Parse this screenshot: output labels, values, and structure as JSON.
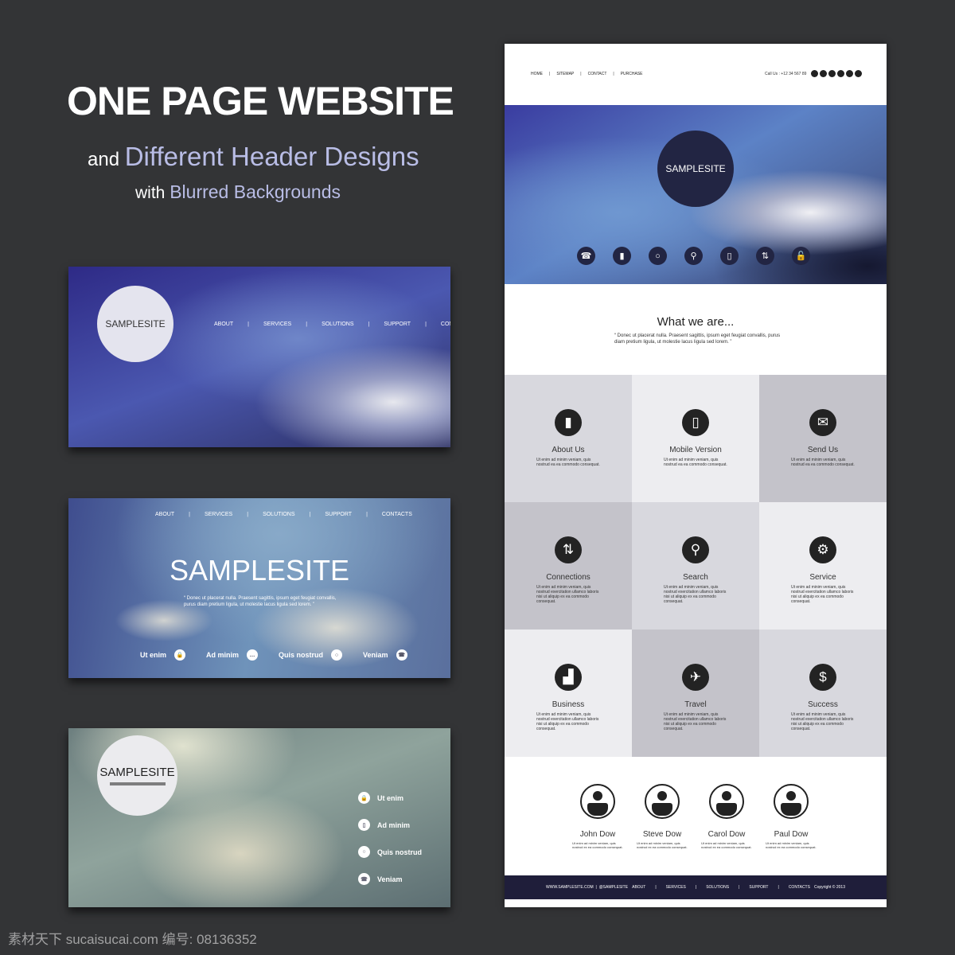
{
  "promo": {
    "title": "ONE PAGE WEBSITE",
    "line2_prefix": "and",
    "line2_accent": "Different Header Designs",
    "line3_prefix": "with",
    "line3_accent": "Blurred Backgrounds"
  },
  "banner1": {
    "logo": "SAMPLESITE",
    "nav": [
      "ABOUT",
      "SERVICES",
      "SOLUTIONS",
      "SUPPORT",
      "CONTACTS"
    ]
  },
  "banner2": {
    "nav": [
      "ABOUT",
      "SERVICES",
      "SOLUTIONS",
      "SUPPORT",
      "CONTACTS"
    ],
    "title": "SAMPLESITE",
    "quote": "Donec ut placerat nulla. Praesent sagittis, ipsum eget feugiat convallis, purus diam pretium ligula, ut molestie lacus ligula sed lorem.",
    "links": [
      {
        "label": "Ut enim",
        "icon": "lock-icon"
      },
      {
        "label": "Ad minim",
        "icon": "chat-icon"
      },
      {
        "label": "Quis nostrud",
        "icon": "circle-icon"
      },
      {
        "label": "Veniam",
        "icon": "phone-icon"
      }
    ]
  },
  "banner3": {
    "logo": "SAMPLESITE",
    "links": [
      {
        "label": "Ut enim",
        "icon": "lock-icon"
      },
      {
        "label": "Ad minim",
        "icon": "mobile-icon"
      },
      {
        "label": "Quis nostrud",
        "icon": "circle-icon"
      },
      {
        "label": "Veniam",
        "icon": "phone-icon"
      }
    ]
  },
  "page": {
    "topnav": [
      "HOME",
      "SITEMAP",
      "CONTACT",
      "PURCHASE"
    ],
    "call": "Call Us : +12 34 567 89",
    "social": [
      "home-icon",
      "star-icon",
      "rss-icon",
      "share-icon",
      "mail-icon",
      "chat-icon"
    ],
    "hero_logo": "SAMPLESITE",
    "hero_icons": [
      {
        "glyph": "☎",
        "name": "phone-icon"
      },
      {
        "glyph": "▮",
        "name": "book-icon"
      },
      {
        "glyph": "○",
        "name": "circle-icon"
      },
      {
        "glyph": "⚲",
        "name": "search-icon"
      },
      {
        "glyph": "▯",
        "name": "mobile-icon"
      },
      {
        "glyph": "⇅",
        "name": "connections-icon"
      },
      {
        "glyph": "🔓",
        "name": "unlock-icon"
      }
    ],
    "about_title": "What we are...",
    "about_quote": "Donec ut placerat nulla. Praesent sagittis, ipsum eget feugiat convallis, purus diam pretium ligula, ut molestie lacus ligula sed lorem.",
    "features": [
      {
        "title": "About Us",
        "icon": "book-icon",
        "glyph": "▮",
        "desc": "Ut enim ad minim veniam, quis nostrud ea ea commodo consequat.",
        "bg": "#d8d8de"
      },
      {
        "title": "Mobile Version",
        "icon": "mobile-icon",
        "glyph": "▯",
        "desc": "Ut enim ad minim veniam, quis nostrud ea ea commodo consequat.",
        "bg": "#ededf0"
      },
      {
        "title": "Send Us",
        "icon": "envelope-icon",
        "glyph": "✉",
        "desc": "Ut enim ad minim veniam, quis nostrud ea ea commodo consequat.",
        "bg": "#c4c3ca"
      },
      {
        "title": "Connections",
        "icon": "connections-icon",
        "glyph": "⇅",
        "desc": "Ut enim ad minim veniam, quis nostrud exercitation ullamco laboris nisi ut aliquip ex ea commodo consequat.",
        "bg": "#c4c3ca"
      },
      {
        "title": "Search",
        "icon": "search-icon",
        "glyph": "⚲",
        "desc": "Ut enim ad minim veniam, quis nostrud exercitation ullamco laboris nisi ut aliquip ex ea commodo consequat.",
        "bg": "#d8d8de"
      },
      {
        "title": "Service",
        "icon": "gear-icon",
        "glyph": "⚙",
        "desc": "Ut enim ad minim veniam, quis nostrud exercitation ullamco laboris nisi ut aliquip ex ea commodo consequat.",
        "bg": "#ededf0"
      },
      {
        "title": "Business",
        "icon": "chart-icon",
        "glyph": "▟",
        "desc": "Ut enim ad minim veniam, quis nostrud exercitation ullamco laboris nisi ut aliquip ex ea commodo consequat.",
        "bg": "#ededf0"
      },
      {
        "title": "Travel",
        "icon": "airplane-icon",
        "glyph": "✈",
        "desc": "Ut enim ad minim veniam, quis nostrud exercitation ullamco laboris nisi ut aliquip ex ea commodo consequat.",
        "bg": "#c4c3ca"
      },
      {
        "title": "Success",
        "icon": "dollar-icon",
        "glyph": "$",
        "desc": "Ut enim ad minim veniam, quis nostrud exercitation ullamco laboris nisi ut aliquip ex ea commodo consequat.",
        "bg": "#d8d8de"
      }
    ],
    "team": [
      {
        "name": "John Dow",
        "desc": "Ut enim ad minim veniam, quis nostrud ex ea commodo consequat."
      },
      {
        "name": "Steve Dow",
        "desc": "Ut enim ad minim veniam, quis nostrud ex ea commodo consequat."
      },
      {
        "name": "Carol Dow",
        "desc": "Ut enim ad minim veniam, quis nostrud ex ea commodo consequat."
      },
      {
        "name": "Paul Dow",
        "desc": "Ut enim ad minim veniam, quis nostrud ex ea commodo consequat."
      }
    ],
    "footer": {
      "site": "WWW.SAMPLESITE.COM",
      "handle": "@SAMPLESITE",
      "nav": [
        "ABOUT",
        "SERVICES",
        "SOLUTIONS",
        "SUPPORT",
        "CONTACTS"
      ],
      "copyright": "Copyright © 2013"
    }
  },
  "watermark": "素材天下 sucaisucai.com  编号: 08136352",
  "colors": {
    "background": "#333436",
    "accent": "#b9bde6",
    "footer": "#1f1e3a",
    "icon": "#232323"
  }
}
